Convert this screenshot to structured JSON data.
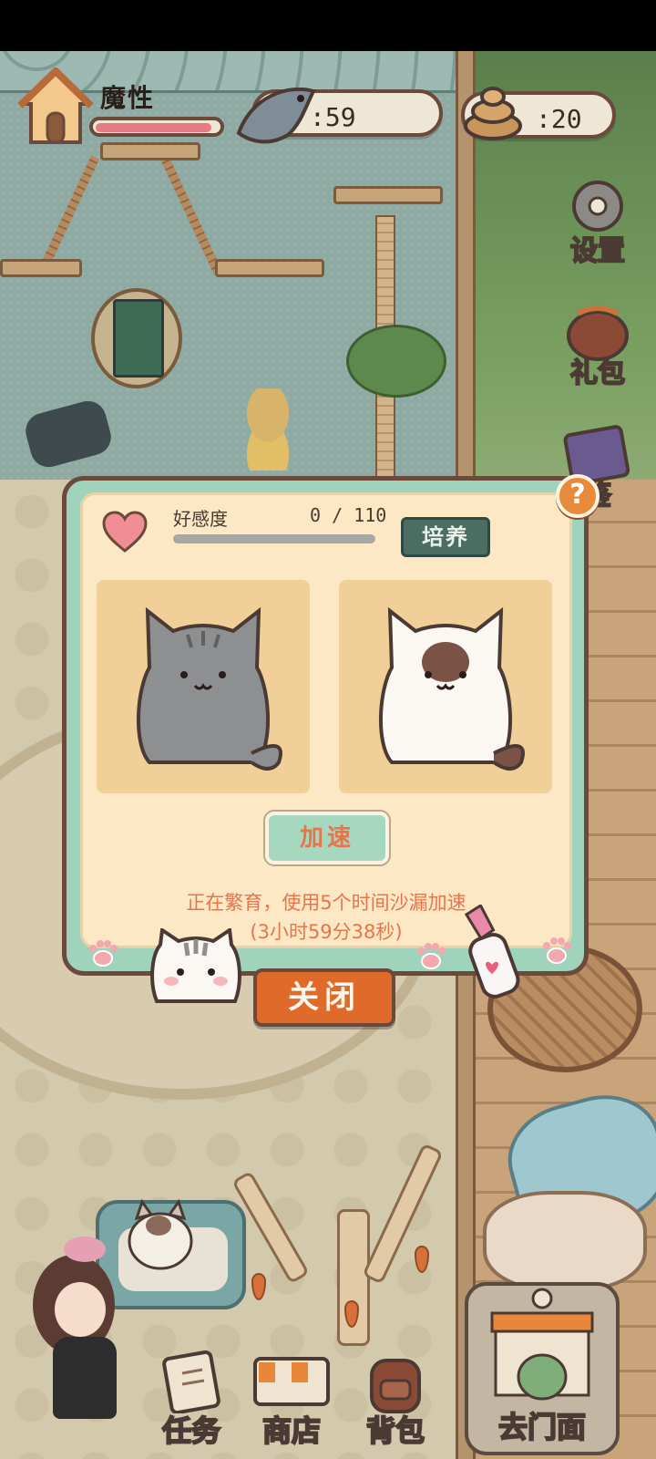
{
  "hud": {
    "player_name": "魔性",
    "hp_fraction": 0.95,
    "fish_count": ":59",
    "coin_count": ":20"
  },
  "side_menu": {
    "settings_label": "设置",
    "gift_label": "礼包",
    "guide_label": "鉴"
  },
  "dialog": {
    "help_label": "?",
    "affection_label": "好感度",
    "affection_value": "0 / 110",
    "affection_fraction": 0,
    "train_label": "培养",
    "speedup_label": "加速",
    "status_line1": "正在繁育，使用5个时间沙漏加速",
    "status_line2": "(3小时59分38秒)",
    "close_label": "关闭"
  },
  "bottom_nav": {
    "tasks_label": "任务",
    "shop_label": "商店",
    "bag_label": "背包",
    "storefront_label": "去门面"
  },
  "colors": {
    "accent_orange": "#e06a2a",
    "panel_green": "#9fd3bb",
    "panel_cream": "#fde8c6",
    "heart_pink": "#e77a83"
  }
}
